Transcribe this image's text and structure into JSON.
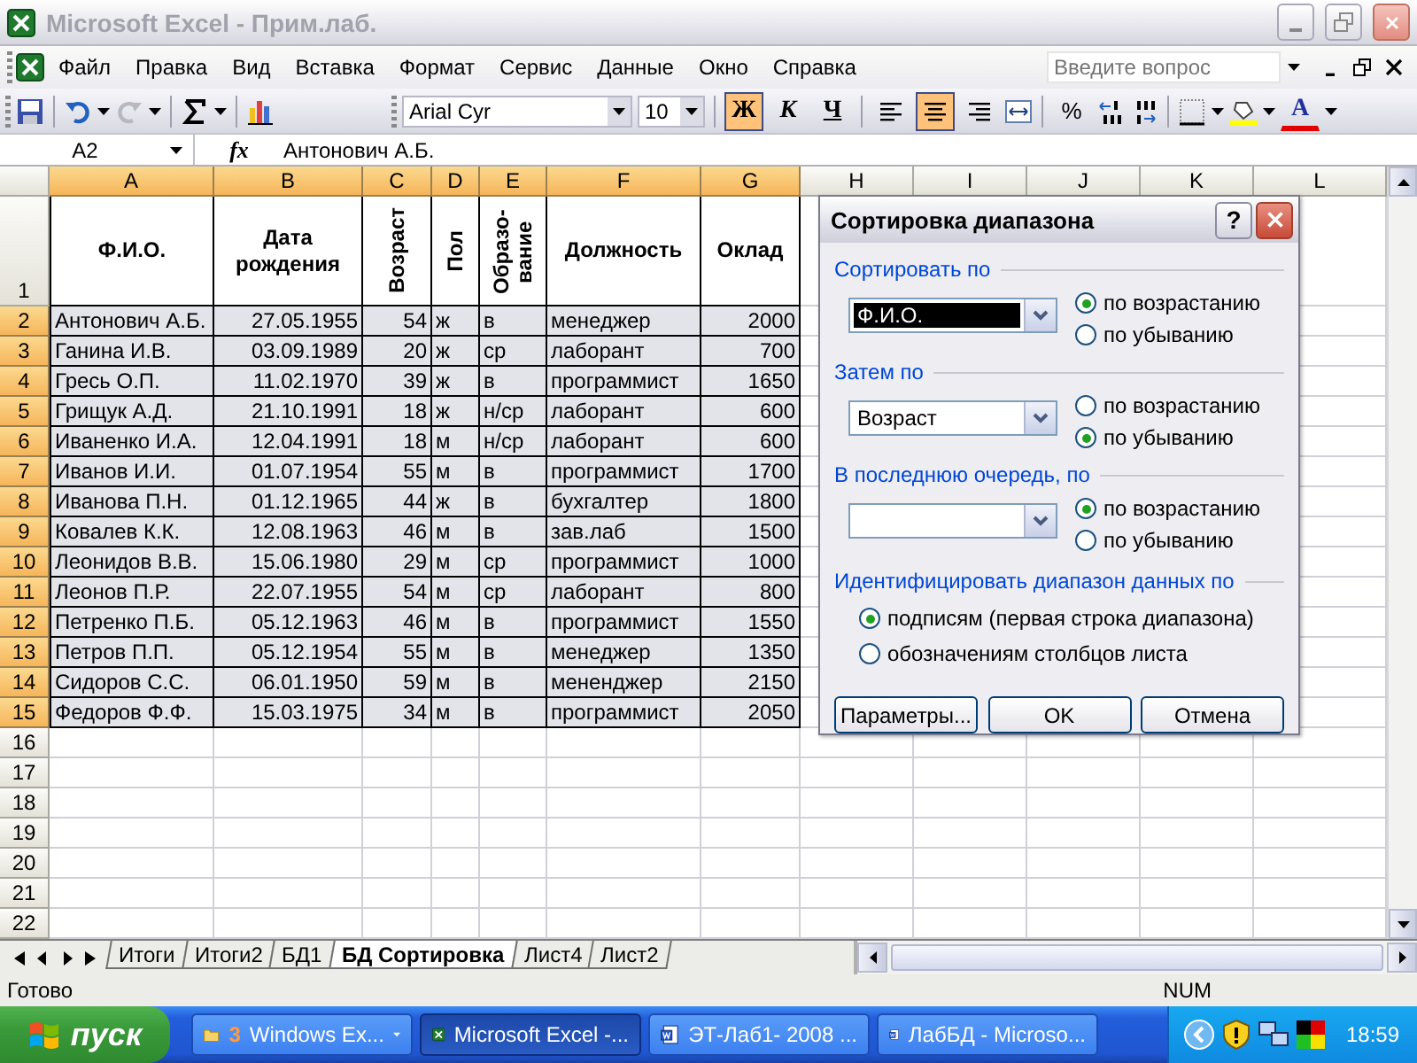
{
  "window": {
    "title": "Microsoft Excel - Прим.лаб."
  },
  "menu": [
    "Файл",
    "Правка",
    "Вид",
    "Вставка",
    "Формат",
    "Сервис",
    "Данные",
    "Окно",
    "Справка"
  ],
  "help_search": {
    "placeholder": "Введите вопрос"
  },
  "toolbar": {
    "font": "Arial Cyr",
    "size": "10",
    "styles": [
      {
        "label": "Ж",
        "on": true
      },
      {
        "label": "К",
        "on": false
      },
      {
        "label": "Ч",
        "on": false
      }
    ],
    "align": [
      {
        "kind": "left",
        "on": false
      },
      {
        "kind": "center",
        "on": true
      },
      {
        "kind": "right",
        "on": false
      }
    ],
    "percent": "%",
    "font_color": "A"
  },
  "formula_bar": {
    "name_box": "A2",
    "fx": "fx",
    "value": "Антонович А.Б."
  },
  "columns": [
    {
      "letter": "A",
      "selected": true,
      "kind": "horizontal"
    },
    {
      "letter": "B",
      "selected": true,
      "kind": "horizontal"
    },
    {
      "letter": "C",
      "selected": true,
      "kind": "vertical"
    },
    {
      "letter": "D",
      "selected": true,
      "kind": "vertical"
    },
    {
      "letter": "E",
      "selected": true,
      "kind": "vertical"
    },
    {
      "letter": "F",
      "selected": true,
      "kind": "horizontal"
    },
    {
      "letter": "G",
      "selected": true,
      "kind": "horizontal"
    },
    {
      "letter": "H",
      "selected": false
    },
    {
      "letter": "I",
      "selected": false
    },
    {
      "letter": "J",
      "selected": false
    },
    {
      "letter": "K",
      "selected": false
    },
    {
      "letter": "L",
      "selected": false
    }
  ],
  "rows": [
    {
      "number": "1",
      "selected": false,
      "cells": [
        "Ф.И.О.",
        "Дата рождения",
        "Возраст",
        "Пол",
        "Образо-вание",
        "Должность",
        "Оклад"
      ]
    },
    {
      "number": "2",
      "selected": true,
      "cells": [
        "Антонович А.Б.",
        "27.05.1955",
        "54",
        "ж",
        "в",
        "менеджер",
        "2000"
      ]
    },
    {
      "number": "3",
      "selected": true,
      "cells": [
        "Ганина И.В.",
        "03.09.1989",
        "20",
        "ж",
        "ср",
        "лаборант",
        "700"
      ]
    },
    {
      "number": "4",
      "selected": true,
      "cells": [
        "Гресь О.П.",
        "11.02.1970",
        "39",
        "ж",
        "в",
        "программист",
        "1650"
      ]
    },
    {
      "number": "5",
      "selected": true,
      "cells": [
        "Грищук А.Д.",
        "21.10.1991",
        "18",
        "ж",
        "н/ср",
        "лаборант",
        "600"
      ]
    },
    {
      "number": "6",
      "selected": true,
      "cells": [
        "Иваненко И.А.",
        "12.04.1991",
        "18",
        "м",
        "н/ср",
        "лаборант",
        "600"
      ]
    },
    {
      "number": "7",
      "selected": true,
      "cells": [
        "Иванов И.И.",
        "01.07.1954",
        "55",
        "м",
        "в",
        "программист",
        "1700"
      ]
    },
    {
      "number": "8",
      "selected": true,
      "cells": [
        "Иванова П.Н.",
        "01.12.1965",
        "44",
        "ж",
        "в",
        "бухгалтер",
        "1800"
      ]
    },
    {
      "number": "9",
      "selected": true,
      "cells": [
        "Ковалев К.К.",
        "12.08.1963",
        "46",
        "м",
        "в",
        "зав.лаб",
        "1500"
      ]
    },
    {
      "number": "10",
      "selected": true,
      "cells": [
        "Леонидов В.В.",
        "15.06.1980",
        "29",
        "м",
        "ср",
        "программист",
        "1000"
      ]
    },
    {
      "number": "11",
      "selected": true,
      "cells": [
        "Леонов П.Р.",
        "22.07.1955",
        "54",
        "м",
        "ср",
        "лаборант",
        "800"
      ]
    },
    {
      "number": "12",
      "selected": true,
      "cells": [
        "Петренко П.Б.",
        "05.12.1963",
        "46",
        "м",
        "в",
        "программист",
        "1550"
      ]
    },
    {
      "number": "13",
      "selected": true,
      "cells": [
        "Петров П.П.",
        "05.12.1954",
        "55",
        "м",
        "в",
        "менеджер",
        "1350"
      ]
    },
    {
      "number": "14",
      "selected": true,
      "cells": [
        "Сидоров С.С.",
        "06.01.1950",
        "59",
        "м",
        "в",
        "мененджер",
        "2150"
      ]
    },
    {
      "number": "15",
      "selected": true,
      "cells": [
        "Федоров Ф.Ф.",
        "15.03.1975",
        "34",
        "м",
        "в",
        "программист",
        "2050"
      ]
    },
    {
      "number": "16",
      "selected": false
    },
    {
      "number": "17",
      "selected": false
    },
    {
      "number": "18",
      "selected": false
    },
    {
      "number": "19",
      "selected": false
    },
    {
      "number": "20",
      "selected": false
    },
    {
      "number": "21",
      "selected": false
    },
    {
      "number": "22",
      "selected": false
    }
  ],
  "sheet_tabs": [
    {
      "label": "Итоги",
      "selected": false
    },
    {
      "label": "Итоги2",
      "selected": false
    },
    {
      "label": "БД1",
      "selected": false
    },
    {
      "label": "БД Сортировка",
      "selected": true
    },
    {
      "label": "Лист4",
      "selected": false
    },
    {
      "label": "Лист2",
      "selected": false
    }
  ],
  "status_bar": {
    "text": "Готово",
    "num": "NUM"
  },
  "dialog": {
    "title": "Сортировка диапазона",
    "help": "?",
    "sort_keys": [
      {
        "label": "Сортировать по",
        "value": "Ф.И.О.",
        "focused": true,
        "options": [
          {
            "label": "по возрастанию",
            "selected": true
          },
          {
            "label": "по убыванию",
            "selected": false
          }
        ]
      },
      {
        "label": "Затем по",
        "value": "Возраст",
        "focused": false,
        "options": [
          {
            "label": "по возрастанию",
            "selected": false
          },
          {
            "label": "по убыванию",
            "selected": true
          }
        ]
      },
      {
        "label": "В последнюю очередь, по",
        "focused": false,
        "options": [
          {
            "label": "по возрастанию",
            "selected": true
          },
          {
            "label": "по убыванию",
            "selected": false
          }
        ]
      }
    ],
    "range_label": "Идентифицировать диапазон данных по",
    "range_options": [
      {
        "label": "подписям (первая строка диапазона)",
        "selected": true
      },
      {
        "label": "обозначениям столбцов листа",
        "selected": false
      }
    ],
    "buttons": [
      "Параметры...",
      "OK",
      "Отмена"
    ]
  },
  "taskbar": {
    "start": "пуск",
    "tasks": [
      {
        "count": "3",
        "label": "Windows Ex...",
        "kind": "group",
        "selected": false
      },
      {
        "label": "Microsoft Excel -...",
        "kind": "excel",
        "selected": true
      },
      {
        "label": "ЭТ-Лаб1- 2008 ...",
        "kind": "word",
        "selected": false
      },
      {
        "label": "ЛабБД - Microso...",
        "kind": "word",
        "selected": false
      }
    ],
    "clock": "18:59"
  }
}
